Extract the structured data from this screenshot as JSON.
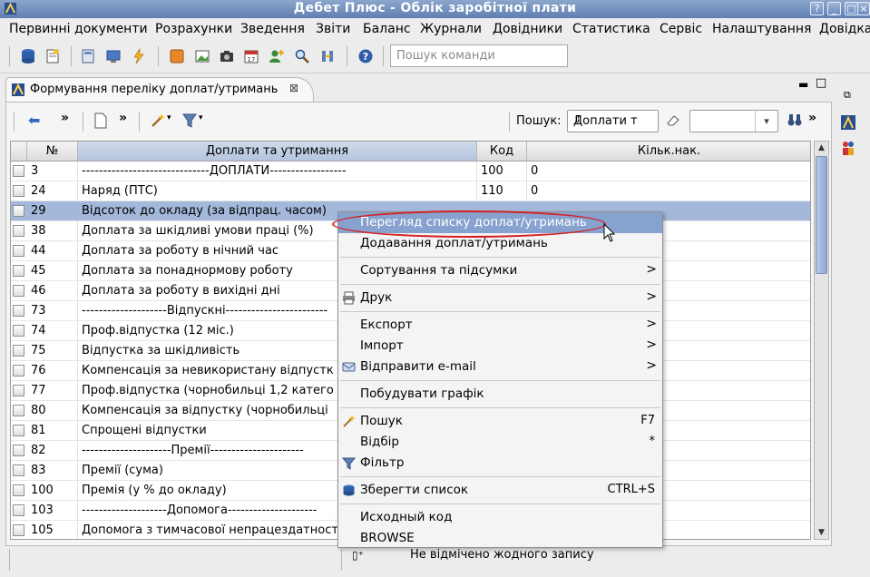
{
  "window": {
    "title": "Дебет Плюс - Облік заробітної плати"
  },
  "menubar": [
    "Первинні документи",
    "Розрахунки",
    "Зведення",
    "Звіти",
    "Баланс",
    "Журнали",
    "Довідники",
    "Статистика",
    "Сервіс",
    "Налаштування",
    "Довідка"
  ],
  "toolbar": {
    "command_search_placeholder": "Пошук команди"
  },
  "tab": {
    "label": "Формування переліку доплат/утримань"
  },
  "inner_toolbar": {
    "search_label": "Пошук:",
    "search_field": "Доплати т"
  },
  "table": {
    "columns": [
      "№",
      "Доплати та утримання",
      "Код",
      "Кільк.нак."
    ],
    "rows": [
      {
        "no": "3",
        "name": "------------------------------ДОПЛАТИ------------------",
        "code": "100",
        "count": "0"
      },
      {
        "no": "24",
        "name": "Наряд (ПТС)",
        "code": "110",
        "count": "0"
      },
      {
        "no": "29",
        "name": "Відсоток до окладу (за відпрац. часом)",
        "code": "",
        "count": ""
      },
      {
        "no": "38",
        "name": "Доплата за шкідливі умови праці (%)",
        "code": "",
        "count": ""
      },
      {
        "no": "44",
        "name": "Доплата за роботу в нічний час",
        "code": "",
        "count": ""
      },
      {
        "no": "45",
        "name": "Доплата за понаднормову роботу",
        "code": "",
        "count": ""
      },
      {
        "no": "46",
        "name": "Доплата за роботу в вихідні дні",
        "code": "",
        "count": ""
      },
      {
        "no": "73",
        "name": "--------------------Відпускні------------------------",
        "code": "",
        "count": ""
      },
      {
        "no": "74",
        "name": "Проф.відпустка (12 міс.)",
        "code": "",
        "count": ""
      },
      {
        "no": "75",
        "name": "Відпустка за шкідливість",
        "code": "",
        "count": ""
      },
      {
        "no": "76",
        "name": "Компенсація за невикористану відпустк",
        "code": "",
        "count": ""
      },
      {
        "no": "77",
        "name": "Проф.відпустка (чорнобильці 1,2 катего",
        "code": "",
        "count": ""
      },
      {
        "no": "80",
        "name": "Компенсація за відпустку (чорнобильці",
        "code": "",
        "count": ""
      },
      {
        "no": "81",
        "name": "Спрощені відпустки",
        "code": "",
        "count": ""
      },
      {
        "no": "82",
        "name": "---------------------Премії----------------------",
        "code": "",
        "count": ""
      },
      {
        "no": "83",
        "name": "Премії (сума)",
        "code": "",
        "count": ""
      },
      {
        "no": "100",
        "name": "Премія (у % до окладу)",
        "code": "",
        "count": ""
      },
      {
        "no": "103",
        "name": "--------------------Допомога---------------------",
        "code": "",
        "count": ""
      },
      {
        "no": "105",
        "name": "Допомога з тимчасової непрацездатност",
        "code": "",
        "count": ""
      }
    ]
  },
  "context_menu": {
    "items": [
      {
        "label": "Перегляд списку доплат/утримань",
        "highlighted": true
      },
      {
        "label": "Додавання доплат/утримань"
      },
      {
        "label": "Сортування та підсумки",
        "submenu": true
      },
      {
        "label": "Друк",
        "submenu": true,
        "icon": "printer-icon"
      },
      {
        "label": "Експорт",
        "submenu": true
      },
      {
        "label": "Імпорт",
        "submenu": true
      },
      {
        "label": "Відправити e-mail",
        "submenu": true,
        "icon": "email-icon"
      },
      {
        "label": "Побудувати графік"
      },
      {
        "label": "Пошук",
        "shortcut": "F7",
        "icon": "search-wand-icon"
      },
      {
        "label": "Відбір",
        "shortcut": "*"
      },
      {
        "label": "Фільтр",
        "icon": "filter-icon"
      },
      {
        "label": "Зберегти список",
        "shortcut": "CTRL+S",
        "icon": "save-icon"
      },
      {
        "label": "Исходный код"
      },
      {
        "label": "BROWSE"
      }
    ]
  },
  "status": {
    "text": "Не відмічено жодного запису"
  },
  "colors": {
    "selection": "#a3b8da",
    "menu_highlight": "#87a2cf",
    "annotation": "#d42020"
  }
}
